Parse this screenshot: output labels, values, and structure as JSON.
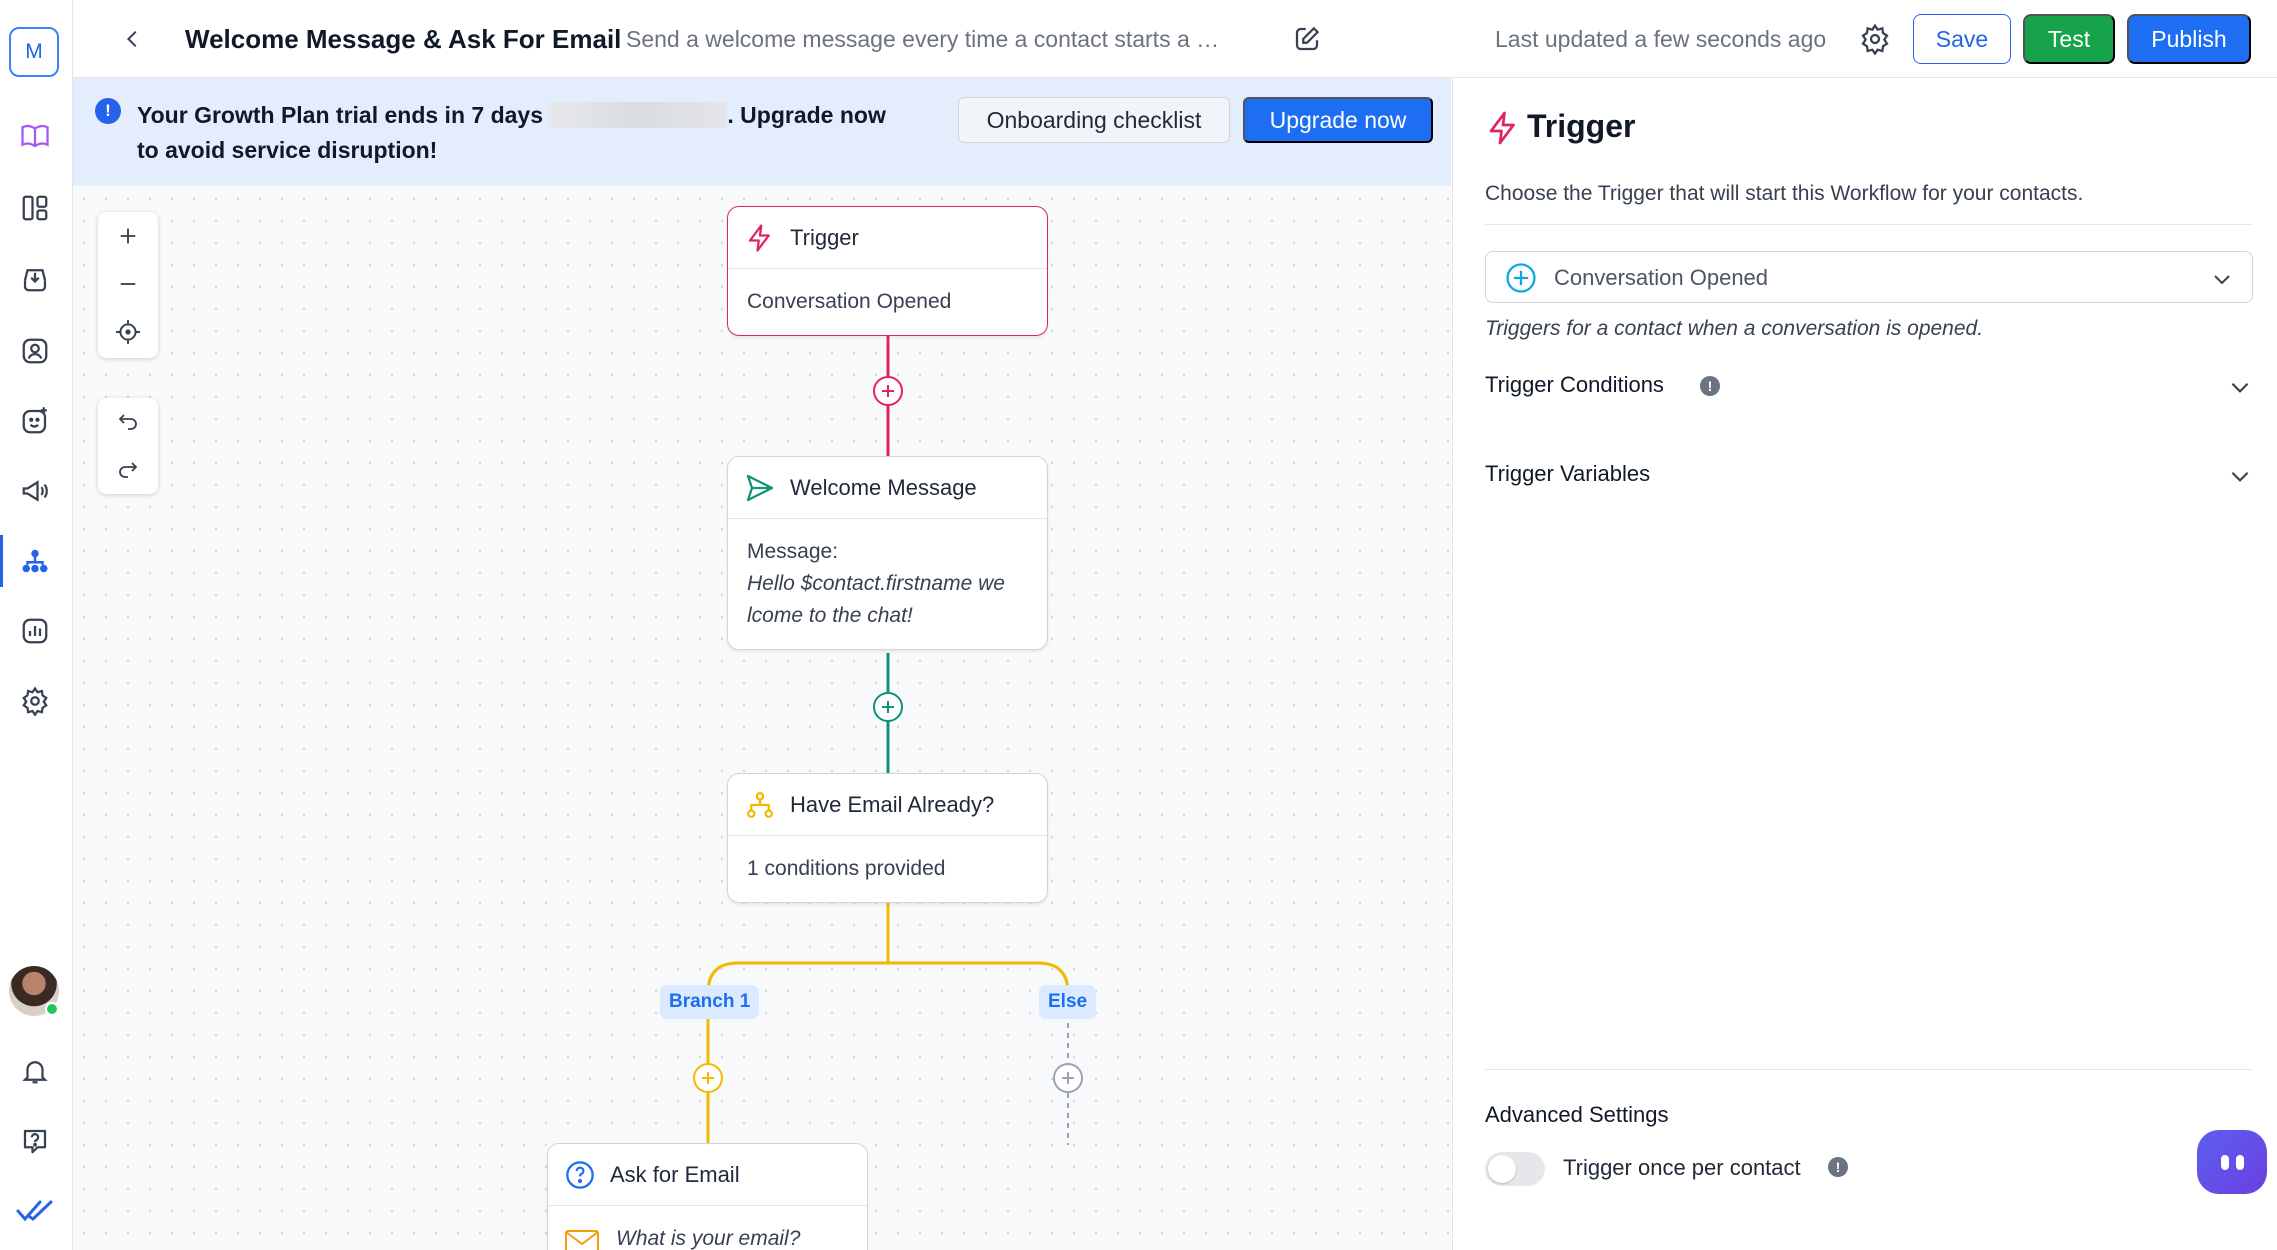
{
  "app": {
    "logo_letter": "M"
  },
  "rail": {
    "items": [
      {
        "icon": "book-icon"
      },
      {
        "icon": "layout-icon"
      },
      {
        "icon": "inbox-icon"
      },
      {
        "icon": "contacts-icon"
      },
      {
        "icon": "emoji-icon"
      },
      {
        "icon": "megaphone-icon"
      },
      {
        "icon": "workflow-icon",
        "active": true
      },
      {
        "icon": "reports-icon"
      },
      {
        "icon": "settings-icon"
      }
    ],
    "bottom": [
      {
        "icon": "bell-icon"
      },
      {
        "icon": "help-icon"
      },
      {
        "icon": "checkmark-logo-icon"
      }
    ]
  },
  "header": {
    "title": "Welcome Message & Ask For Email",
    "description": "Send a welcome message every time a contact starts a co...",
    "last_updated": "Last updated a few seconds ago",
    "save_label": "Save",
    "test_label": "Test",
    "publish_label": "Publish"
  },
  "banner": {
    "text_before": "Your Growth Plan trial ends in 7 days",
    "text_after": ". Upgrade now to avoid service disruption!",
    "onboarding_label": "Onboarding checklist",
    "upgrade_label": "Upgrade now"
  },
  "workflow": {
    "trigger_node": {
      "title": "Trigger",
      "body": "Conversation Opened"
    },
    "message_node": {
      "title": "Welcome Message",
      "label": "Message:",
      "text": "Hello $contact.firstname we lcome to the chat!"
    },
    "condition_node": {
      "title": "Have Email Already?",
      "body": "1 conditions provided"
    },
    "branches": [
      "Branch 1",
      "Else"
    ],
    "ask_node": {
      "title": "Ask for Email",
      "question": "What is your email?"
    }
  },
  "panel": {
    "title": "Trigger",
    "subtitle": "Choose the Trigger that will start this Workflow for your contacts.",
    "selected_trigger": "Conversation Opened",
    "trigger_hint": "Triggers for a contact when a conversation is opened.",
    "conditions_label": "Trigger Conditions",
    "variables_label": "Trigger Variables",
    "advanced_title": "Advanced Settings",
    "toggle_label": "Trigger once per contact",
    "toggle_on": false
  },
  "colors": {
    "primary": "#1d6ef2",
    "success": "#16a34a",
    "trigger": "#e0245e",
    "message": "#0f9278",
    "condition": "#f5b800"
  }
}
